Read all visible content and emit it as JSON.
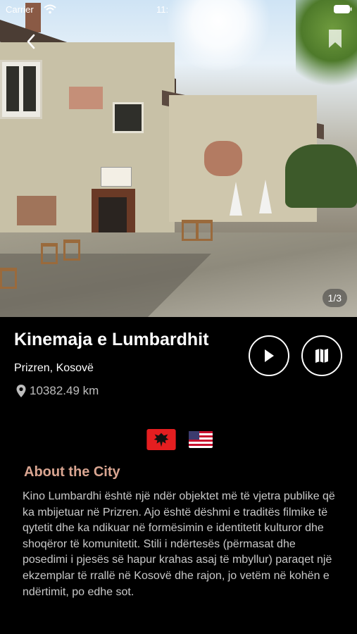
{
  "status_bar": {
    "carrier": "Carrier",
    "time": "11:"
  },
  "gallery": {
    "counter": "1/3"
  },
  "place": {
    "title": "Kinemaja e Lumbardhit",
    "location": "Prizren, Kosovë",
    "distance": "10382.49 km"
  },
  "icons": {
    "back": "chevron-left-icon",
    "bookmark": "bookmark-icon",
    "wifi": "wifi-icon",
    "battery": "battery-icon",
    "play": "play-icon",
    "map": "map-icon",
    "pin": "location-pin-icon"
  },
  "languages": [
    {
      "name": "albanian-flag"
    },
    {
      "name": "us-flag"
    }
  ],
  "about": {
    "title": "About the City",
    "text": "Kino Lumbardhi është një ndër objektet më të vjetra publike që ka mbijetuar në Prizren. Ajo është dëshmi e traditës filmike të qytetit dhe ka ndikuar në formësimin e identitetit kulturor dhe shoqëror të komunitetit. Stili i ndërtesës (përmasat dhe posedimi i pjesës së hapur krahas asaj të mbyllur) paraqet një ekzemplar të rrallë në Kosovë dhe rajon, jo vetëm në kohën e ndërtimit, po edhe sot."
  },
  "colors": {
    "background": "#000000",
    "accent": "#d9a591",
    "body_text": "#c9c9c9"
  }
}
